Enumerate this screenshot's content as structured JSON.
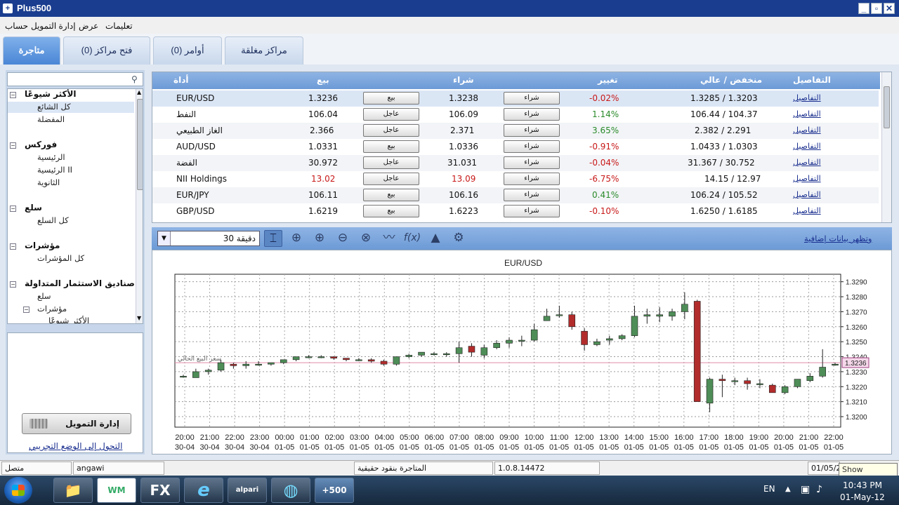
{
  "window": {
    "title": "Plus500",
    "app_icon": "+",
    "minimize": "_",
    "restore": "▫",
    "close": "✕"
  },
  "menu": [
    "تعليمات",
    "عرض",
    "إدارة التمويل",
    "حساب"
  ],
  "tabs": [
    {
      "label": "متاجرة",
      "active": true
    },
    {
      "label": "فتح مراكز (0)"
    },
    {
      "label": "أوامر (0)"
    },
    {
      "label": "مراكز مغلقة"
    }
  ],
  "sidebar": {
    "search_placeholder": "",
    "search_icon": "search-icon",
    "tree": [
      {
        "type": "group",
        "label": "الأكثر شيوعًا",
        "expander": "⊟"
      },
      {
        "type": "item",
        "label": "كل الشائع",
        "selected": true
      },
      {
        "type": "item",
        "label": "المفضلة"
      },
      {
        "type": "group",
        "label": "فوركس",
        "expander": "⊟"
      },
      {
        "type": "item",
        "label": "الرئيسية"
      },
      {
        "type": "item",
        "label": "الرئيسية II"
      },
      {
        "type": "item",
        "label": "الثانوية"
      },
      {
        "type": "group",
        "label": "سلع",
        "expander": "⊟"
      },
      {
        "type": "item",
        "label": "كل السلع"
      },
      {
        "type": "group",
        "label": "مؤشرات",
        "expander": "⊟"
      },
      {
        "type": "item",
        "label": "كل المؤشرات"
      },
      {
        "type": "group",
        "label": "صناديق الاستثمار المتداولة",
        "expander": "⊟"
      },
      {
        "type": "item",
        "label": "سلع"
      },
      {
        "type": "item",
        "label": "مؤشرات",
        "expander": "⊟"
      },
      {
        "type": "item",
        "label": "الأكثر شيوعًا"
      }
    ],
    "funding_button": "إدارة التمويل",
    "demo_link": "التحول إلى الوضع التجريبي"
  },
  "table": {
    "headers": {
      "details": "التفاصيل",
      "high_low": "منخفض / عالي",
      "change": "تغيير",
      "buy": "شراء",
      "sell": "بيع",
      "instrument": "أداة"
    },
    "rows": [
      {
        "instrument": "EUR/USD",
        "sell": "1.3236",
        "sell_btn": "بيع",
        "buy": "1.3238",
        "buy_btn": "شراء",
        "change": "-0.02%",
        "high_low": "1.3285 / 1.3203",
        "details": "التفاصيل"
      },
      {
        "instrument": "النفط",
        "sell": "106.04",
        "sell_btn": "عاجل",
        "buy": "106.09",
        "buy_btn": "شراء",
        "change": "1.14%",
        "high_low": "106.44 / 104.37",
        "details": "التفاصيل"
      },
      {
        "instrument": "الغاز الطبيعي",
        "sell": "2.366",
        "sell_btn": "عاجل",
        "buy": "2.371",
        "buy_btn": "شراء",
        "change": "3.65%",
        "high_low": "2.382 / 2.291",
        "details": "التفاصيل"
      },
      {
        "instrument": "AUD/USD",
        "sell": "1.0331",
        "sell_btn": "بيع",
        "buy": "1.0336",
        "buy_btn": "شراء",
        "change": "-0.91%",
        "high_low": "1.0433 / 1.0303",
        "details": "التفاصيل"
      },
      {
        "instrument": "الفضة",
        "sell": "30.972",
        "sell_btn": "عاجل",
        "buy": "31.031",
        "buy_btn": "شراء",
        "change": "-0.04%",
        "high_low": "31.367 / 30.752",
        "details": "التفاصيل"
      },
      {
        "instrument": "NII Holdings",
        "sell": "13.02",
        "sell_btn": "عاجل",
        "buy": "13.09",
        "buy_btn": "شراء",
        "change": "-6.75%",
        "high_low": "14.15 / 12.97",
        "details": "التفاصيل",
        "price_red": true
      },
      {
        "instrument": "EUR/JPY",
        "sell": "106.11",
        "sell_btn": "بيع",
        "buy": "106.16",
        "buy_btn": "شراء",
        "change": "0.41%",
        "high_low": "106.24 / 105.52",
        "details": "التفاصيل"
      },
      {
        "instrument": "GBP/USD",
        "sell": "1.6219",
        "sell_btn": "بيع",
        "buy": "1.6223",
        "buy_btn": "شراء",
        "change": "-0.10%",
        "high_low": "1.6250 / 1.6185",
        "details": "التفاصيل"
      }
    ]
  },
  "chart_toolbar": {
    "timeframe": "30 دقيقة",
    "tools": [
      "cursor-icon",
      "crosshair-icon",
      "zoom-in-icon",
      "zoom-out-icon",
      "zoom-reset-icon",
      "line-chart-icon",
      "function-icon",
      "bell-icon",
      "gear-icon"
    ],
    "more_data_link": "وتظهر بيانات إضافية"
  },
  "chart_data": {
    "type": "candlestick",
    "title": "EUR/USD",
    "ylim": [
      1.3193,
      1.3295
    ],
    "y_ticks": [
      "1.3290",
      "1.3280",
      "1.3270",
      "1.3260",
      "1.3250",
      "1.3240",
      "1.3230",
      "1.3220",
      "1.3210",
      "1.3200"
    ],
    "current_price": "1.3236",
    "current_price_label": "سعر البيع الحالي",
    "x_labels": [
      [
        "20:00",
        "30-04"
      ],
      [
        "21:00",
        "30-04"
      ],
      [
        "22:00",
        "30-04"
      ],
      [
        "23:00",
        "30-04"
      ],
      [
        "00:00",
        "01-05"
      ],
      [
        "01:00",
        "01-05"
      ],
      [
        "02:00",
        "01-05"
      ],
      [
        "03:00",
        "01-05"
      ],
      [
        "04:00",
        "01-05"
      ],
      [
        "05:00",
        "01-05"
      ],
      [
        "06:00",
        "01-05"
      ],
      [
        "07:00",
        "01-05"
      ],
      [
        "08:00",
        "01-05"
      ],
      [
        "09:00",
        "01-05"
      ],
      [
        "10:00",
        "01-05"
      ],
      [
        "11:00",
        "01-05"
      ],
      [
        "12:00",
        "01-05"
      ],
      [
        "13:00",
        "01-05"
      ],
      [
        "14:00",
        "01-05"
      ],
      [
        "15:00",
        "01-05"
      ],
      [
        "16:00",
        "01-05"
      ],
      [
        "17:00",
        "01-05"
      ],
      [
        "18:00",
        "01-05"
      ],
      [
        "19:00",
        "01-05"
      ],
      [
        "20:00",
        "01-05"
      ],
      [
        "21:00",
        "01-05"
      ],
      [
        "22:00",
        "01-05"
      ]
    ],
    "candles": [
      [
        1.3227,
        1.3228,
        1.3226,
        1.3227
      ],
      [
        1.3226,
        1.3232,
        1.3226,
        1.323
      ],
      [
        1.323,
        1.3232,
        1.3228,
        1.3231
      ],
      [
        1.3231,
        1.3238,
        1.323,
        1.3236
      ],
      [
        1.3235,
        1.3236,
        1.3232,
        1.3234
      ],
      [
        1.3234,
        1.3237,
        1.3232,
        1.3235
      ],
      [
        1.3235,
        1.3237,
        1.3234,
        1.3235
      ],
      [
        1.3235,
        1.3236,
        1.3234,
        1.3236
      ],
      [
        1.3236,
        1.3238,
        1.3235,
        1.3238
      ],
      [
        1.3238,
        1.324,
        1.3237,
        1.324
      ],
      [
        1.324,
        1.3241,
        1.3239,
        1.324
      ],
      [
        1.324,
        1.3241,
        1.3239,
        1.324
      ],
      [
        1.324,
        1.324,
        1.3238,
        1.3239
      ],
      [
        1.3239,
        1.3239,
        1.3237,
        1.3238
      ],
      [
        1.3238,
        1.3239,
        1.3237,
        1.3238
      ],
      [
        1.3238,
        1.3239,
        1.3236,
        1.3237
      ],
      [
        1.3237,
        1.3238,
        1.3234,
        1.3235
      ],
      [
        1.3235,
        1.324,
        1.3234,
        1.324
      ],
      [
        1.324,
        1.3242,
        1.3239,
        1.3241
      ],
      [
        1.3241,
        1.3242,
        1.324,
        1.3243
      ],
      [
        1.3242,
        1.3243,
        1.3241,
        1.3242
      ],
      [
        1.3242,
        1.3243,
        1.324,
        1.3242
      ],
      [
        1.3242,
        1.325,
        1.3236,
        1.3246
      ],
      [
        1.3247,
        1.3249,
        1.324,
        1.3243
      ],
      [
        1.3241,
        1.3248,
        1.3239,
        1.3246
      ],
      [
        1.3246,
        1.3251,
        1.3245,
        1.3249
      ],
      [
        1.3249,
        1.3253,
        1.3246,
        1.3251
      ],
      [
        1.3251,
        1.3254,
        1.3247,
        1.3251
      ],
      [
        1.3251,
        1.3262,
        1.325,
        1.3258
      ],
      [
        1.3264,
        1.3272,
        1.3265,
        1.3267
      ],
      [
        1.3268,
        1.3274,
        1.3266,
        1.3268
      ],
      [
        1.3268,
        1.327,
        1.3258,
        1.326
      ],
      [
        1.3257,
        1.3259,
        1.3244,
        1.3248
      ],
      [
        1.3248,
        1.3252,
        1.3247,
        1.325
      ],
      [
        1.3251,
        1.3254,
        1.3248,
        1.3252
      ],
      [
        1.3252,
        1.3255,
        1.3251,
        1.3254
      ],
      [
        1.3254,
        1.3274,
        1.3253,
        1.3267
      ],
      [
        1.3267,
        1.3272,
        1.3262,
        1.3268
      ],
      [
        1.3267,
        1.3273,
        1.3263,
        1.3268
      ],
      [
        1.3267,
        1.3272,
        1.3264,
        1.327
      ],
      [
        1.327,
        1.3283,
        1.3265,
        1.3275
      ],
      [
        1.3277,
        1.3278,
        1.321,
        1.321
      ],
      [
        1.3209,
        1.3226,
        1.3203,
        1.3225
      ],
      [
        1.3225,
        1.3228,
        1.3213,
        1.3224
      ],
      [
        1.3224,
        1.3226,
        1.3221,
        1.3224
      ],
      [
        1.3224,
        1.3226,
        1.3218,
        1.3222
      ],
      [
        1.3222,
        1.3225,
        1.3219,
        1.3222
      ],
      [
        1.3221,
        1.3222,
        1.3216,
        1.3216
      ],
      [
        1.3216,
        1.3221,
        1.3215,
        1.322
      ],
      [
        1.322,
        1.3225,
        1.3219,
        1.3225
      ],
      [
        1.3224,
        1.3229,
        1.3223,
        1.3227
      ],
      [
        1.3227,
        1.3245,
        1.3226,
        1.3233
      ],
      [
        1.3235,
        1.3236,
        1.3234,
        1.3235
      ]
    ]
  },
  "statusbar": {
    "connection": "متصل",
    "user": "angawi",
    "mode": "المتاجرة بنقود حقيقية",
    "version": "1.0.8.14472",
    "date": "01/05/2",
    "show_desktop_tooltip": "Show desktop"
  },
  "taskbar": {
    "apps": [
      {
        "name": "file-explorer",
        "label": "📁"
      },
      {
        "name": "wm",
        "label": "WM"
      },
      {
        "name": "fx",
        "label": "FX"
      },
      {
        "name": "internet-explorer",
        "label": "e"
      },
      {
        "name": "alpari",
        "label": "alpari"
      },
      {
        "name": "network-globe",
        "label": "◍"
      },
      {
        "name": "plus500",
        "label": "+500",
        "active": true
      }
    ],
    "language": "EN",
    "tray_up": "▲",
    "tray_net": "▣",
    "tray_vol": "♪",
    "time": "10:43 PM",
    "date": "01-May-12"
  },
  "colors": {
    "up": "#4e8d57",
    "down": "#b22c2c",
    "header": "#7aa6de",
    "title": "#1a3d8f"
  }
}
